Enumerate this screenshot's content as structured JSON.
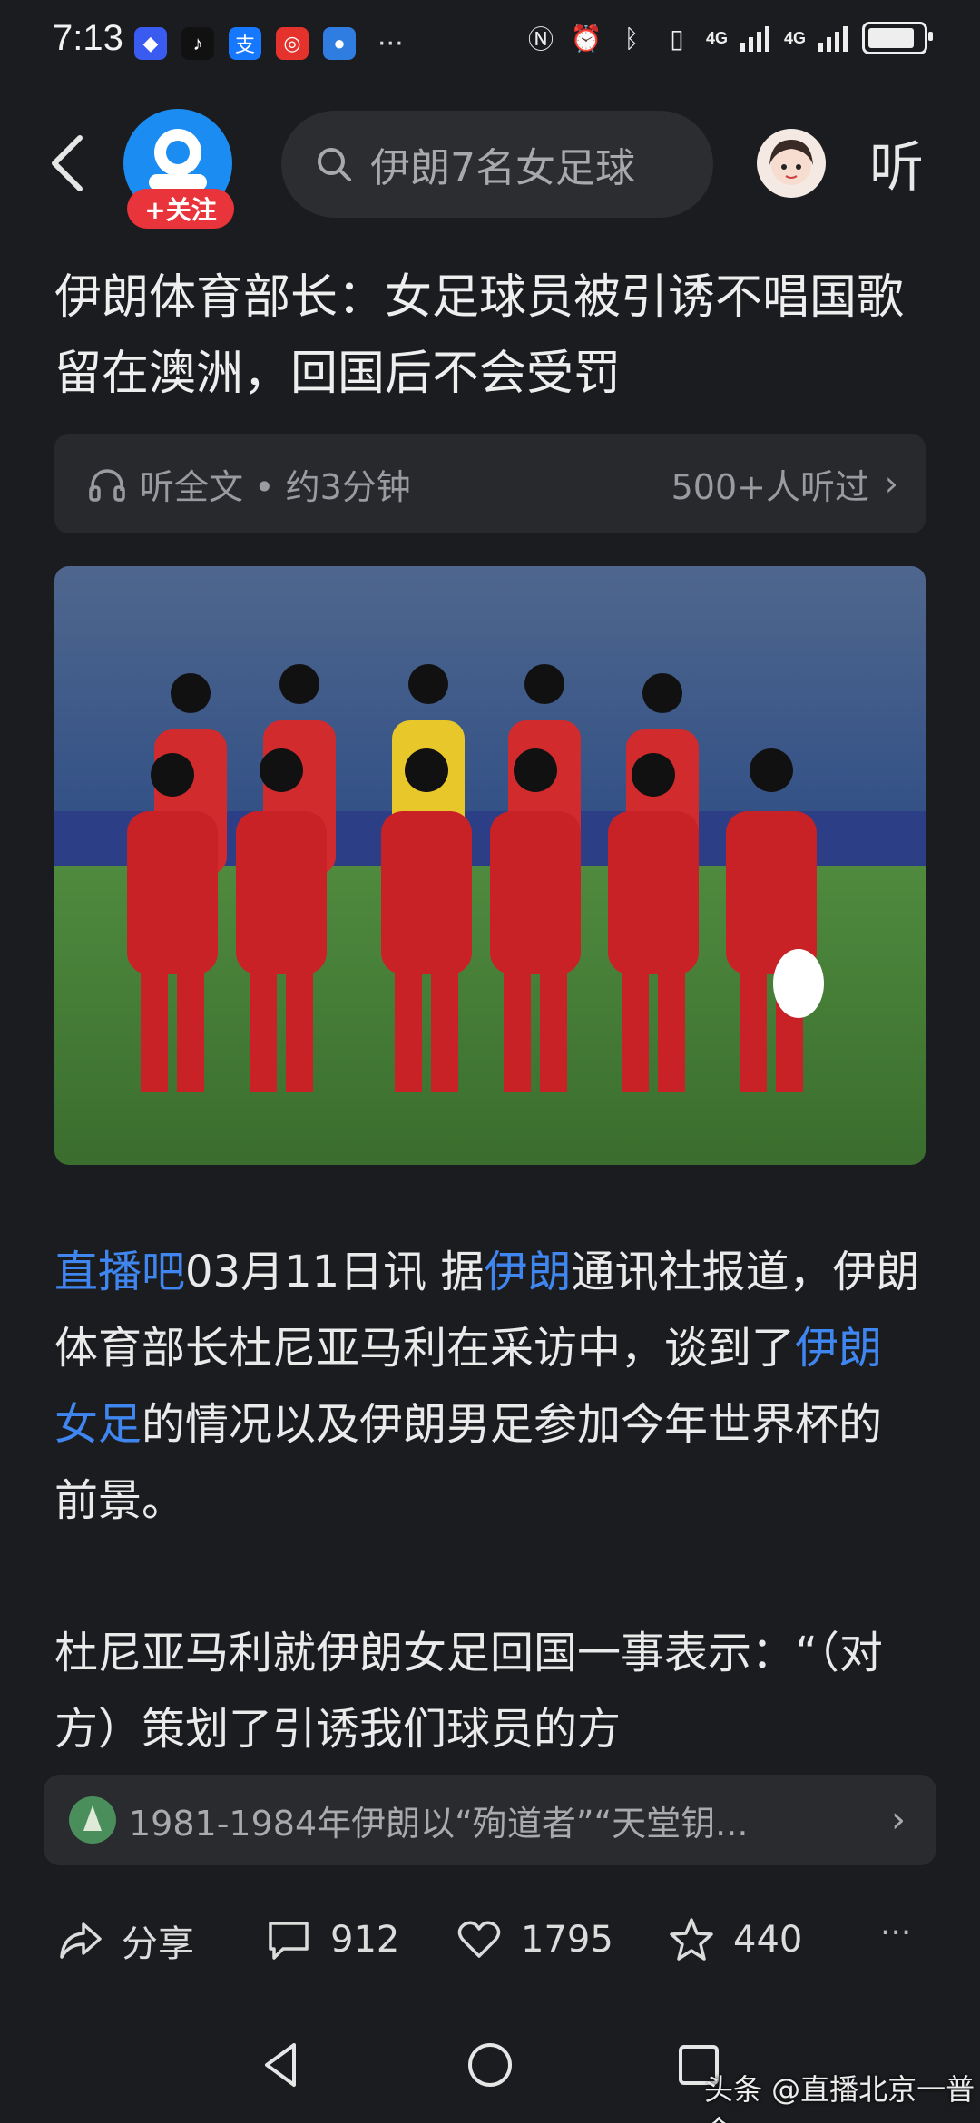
{
  "status_bar": {
    "time": "7:13",
    "apps": [
      {
        "icon": "app-a-icon",
        "color": "#3a5bf0",
        "glyph": "◆"
      },
      {
        "icon": "tiktok-icon",
        "color": "#111111",
        "glyph": "♪"
      },
      {
        "icon": "alipay-icon",
        "color": "#1677ff",
        "glyph": "支"
      },
      {
        "icon": "app-red-icon",
        "color": "#e5322d",
        "glyph": "◎"
      },
      {
        "icon": "app-blue-icon",
        "color": "#2f7de1",
        "glyph": "●"
      }
    ],
    "overflow": "···",
    "net1": "4G",
    "net2": "4G"
  },
  "topbar": {
    "follow_label": "+关注",
    "search_placeholder": "伊朗7名女足球",
    "listen_label": "听"
  },
  "article": {
    "title": "伊朗体育部长：女足球员被引诱不唱国歌留在澳洲，回国后不会受罚",
    "listen_label": "听全文 • 约3分钟",
    "listen_count": "500+人听过",
    "para1": {
      "link1": "直播吧",
      "text1": "03月11日讯 据",
      "link2": "伊朗",
      "text2": "通讯社报道，伊朗体育部长杜尼亚马利在采访中，谈到了",
      "link3": "伊朗女足",
      "text3": "的情况以及伊朗男足参加今年世界杯的前景。"
    },
    "para2": "杜尼亚马利就伊朗女足回国一事表示：“（对方）策划了引诱我们球员的方"
  },
  "related": {
    "text": "1981-1984年伊朗以“殉道者”“天堂钥..."
  },
  "actions": {
    "share_label": "分享",
    "comment_count": "912",
    "like_count": "1795",
    "fav_count": "440",
    "more": "···"
  },
  "watermark": "头条 @直播北京一普金",
  "colors": {
    "background": "#1b1c1f",
    "link": "#3f86f0",
    "follow": "#e8343a",
    "avatar_blue": "#1b8cf2"
  }
}
